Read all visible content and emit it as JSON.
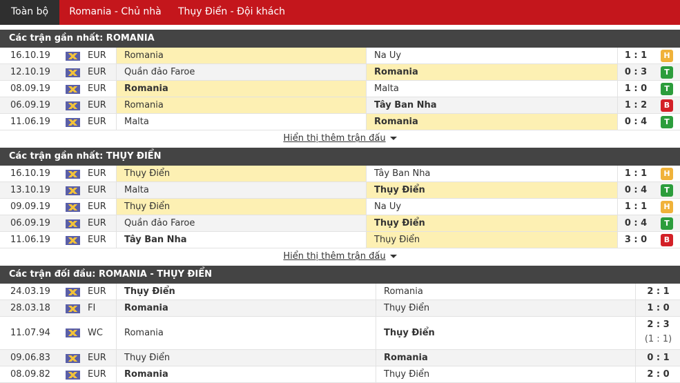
{
  "tabs": [
    "Toàn bộ",
    "Romania - Chủ nhà",
    "Thụy Điển - Đội khách"
  ],
  "section1": {
    "title": "Các trận gần nhất: ROMANIA",
    "rows": [
      {
        "date": "16.10.19",
        "comp": "EUR",
        "home": "Romania",
        "away": "Na Uy",
        "score": "1 : 1",
        "result": "H"
      },
      {
        "date": "12.10.19",
        "comp": "EUR",
        "home": "Quần đảo Faroe",
        "away": "Romania",
        "score": "0 : 3",
        "result": "T"
      },
      {
        "date": "08.09.19",
        "comp": "EUR",
        "home": "Romania",
        "away": "Malta",
        "score": "1 : 0",
        "result": "T"
      },
      {
        "date": "06.09.19",
        "comp": "EUR",
        "home": "Romania",
        "away": "Tây Ban Nha",
        "score": "1 : 2",
        "result": "B"
      },
      {
        "date": "11.06.19",
        "comp": "EUR",
        "home": "Malta",
        "away": "Romania",
        "score": "0 : 4",
        "result": "T"
      }
    ],
    "more": "Hiển thị thêm trận đấu"
  },
  "section2": {
    "title": "Các trận gần nhất: THỤY ĐIỂN",
    "rows": [
      {
        "date": "16.10.19",
        "comp": "EUR",
        "home": "Thụy Điển",
        "away": "Tây Ban Nha",
        "score": "1 : 1",
        "result": "H"
      },
      {
        "date": "13.10.19",
        "comp": "EUR",
        "home": "Malta",
        "away": "Thụy Điển",
        "score": "0 : 4",
        "result": "T"
      },
      {
        "date": "09.09.19",
        "comp": "EUR",
        "home": "Thụy Điển",
        "away": "Na Uy",
        "score": "1 : 1",
        "result": "H"
      },
      {
        "date": "06.09.19",
        "comp": "EUR",
        "home": "Quần đảo Faroe",
        "away": "Thụy Điển",
        "score": "0 : 4",
        "result": "T"
      },
      {
        "date": "11.06.19",
        "comp": "EUR",
        "home": "Tây Ban Nha",
        "away": "Thụy Điển",
        "score": "3 : 0",
        "result": "B"
      }
    ],
    "more": "Hiển thị thêm trận đấu"
  },
  "section3": {
    "title": "Các trận đối đầu: ROMANIA - THỤY ĐIỂN",
    "rows": [
      {
        "date": "24.03.19",
        "comp": "EUR",
        "home": "Thụy Điển",
        "away": "Romania",
        "score": "2 : 1"
      },
      {
        "date": "28.03.18",
        "comp": "FI",
        "home": "Romania",
        "away": "Thụy Điển",
        "score": "1 : 0"
      },
      {
        "date": "11.07.94",
        "comp": "WC",
        "home": "Romania",
        "away": "Thụy Điển",
        "score": "2 : 3",
        "sub": "(1 : 1)"
      },
      {
        "date": "09.06.83",
        "comp": "EUR",
        "home": "Thụy Điển",
        "away": "Romania",
        "score": "0 : 1"
      },
      {
        "date": "08.09.82",
        "comp": "EUR",
        "home": "Romania",
        "away": "Thụy Điển",
        "score": "2 : 0"
      }
    ]
  },
  "colors": {
    "accent": "#c4161c",
    "header_bg": "#444444",
    "highlight": "#fdf0b3",
    "draw": "#f0b23a",
    "win": "#2c9d3c",
    "loss": "#d32027"
  }
}
